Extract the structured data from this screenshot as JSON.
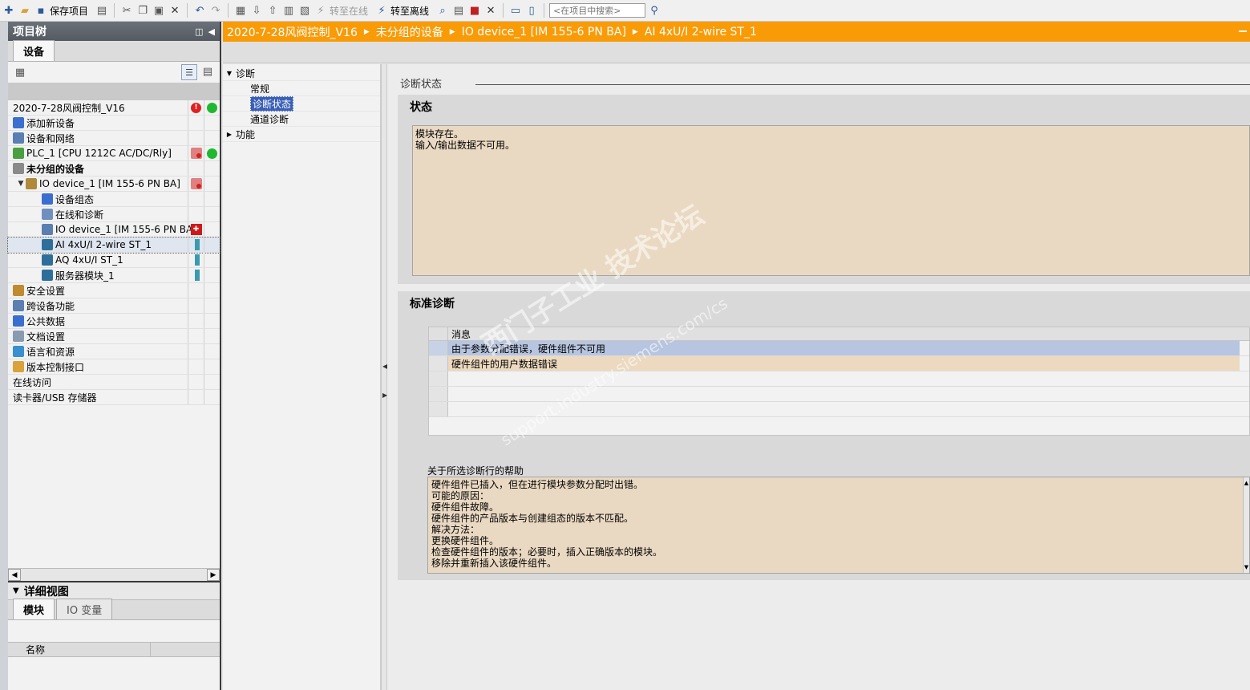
{
  "toolbar": {
    "save_label": "保存项目",
    "go_online_label": "转至在线",
    "go_offline_label": "转至离线",
    "search_placeholder": "<在项目中搜索>"
  },
  "project_tree": {
    "title": "项目树",
    "tab_devices": "设备",
    "items": [
      {
        "label": "2020-7-28风阀控制_V16"
      },
      {
        "label": "添加新设备"
      },
      {
        "label": "设备和网络"
      },
      {
        "label": "PLC_1 [CPU 1212C AC/DC/Rly]"
      },
      {
        "label": "未分组的设备"
      },
      {
        "label": "IO device_1 [IM 155-6 PN BA]"
      },
      {
        "label": "设备组态"
      },
      {
        "label": "在线和诊断"
      },
      {
        "label": "IO device_1 [IM 155-6 PN BA]"
      },
      {
        "label": "AI 4xU/I 2-wire ST_1"
      },
      {
        "label": "AQ 4xU/I ST_1"
      },
      {
        "label": "服务器模块_1"
      },
      {
        "label": "安全设置"
      },
      {
        "label": "跨设备功能"
      },
      {
        "label": "公共数据"
      },
      {
        "label": "文档设置"
      },
      {
        "label": "语言和资源"
      },
      {
        "label": "版本控制接口"
      },
      {
        "label": "在线访问"
      },
      {
        "label": "读卡器/USB 存储器"
      }
    ]
  },
  "detail_view": {
    "title": "详细视图",
    "tab_module": "模块",
    "tab_io_vars": "IO 变量",
    "col_name": "名称"
  },
  "breadcrumb": {
    "items": [
      "2020-7-28风阀控制_V16",
      "未分组的设备",
      "IO device_1 [IM 155-6 PN BA]",
      "AI 4xU/I 2-wire ST_1"
    ]
  },
  "nav": {
    "diagnostics": "诊断",
    "general": "常规",
    "diag_status": "诊断状态",
    "channel_diag": "通道诊断",
    "functions": "功能"
  },
  "content": {
    "section_title": "诊断状态",
    "status_title": "状态",
    "status_lines": [
      "模块存在。",
      "输入/输出数据不可用。"
    ],
    "std_diag_title": "标准诊断",
    "msg_header": "消息",
    "messages": [
      "由于参数分配错误，硬件组件不可用",
      "硬件组件的用户数据错误"
    ],
    "help_label": "关于所选诊断行的帮助",
    "help_lines": [
      "硬件组件已插入，但在进行模块参数分配时出错。",
      "可能的原因：",
      "硬件组件故障。",
      "硬件组件的产品版本与创建组态的版本不匹配。",
      "解决方法：",
      "更换硬件组件。",
      "检查硬件组件的版本；必要时，插入正确版本的模块。",
      "移除并重新插入该硬件组件。"
    ]
  },
  "watermark": {
    "text1": "西门子工业 技术论坛",
    "text2": "support.industry.siemens.com/cs"
  },
  "colors": {
    "breadcrumb_bg": "#f99b07",
    "status_bg": "#ead9c2",
    "selected_row": "#b7c5e0"
  }
}
